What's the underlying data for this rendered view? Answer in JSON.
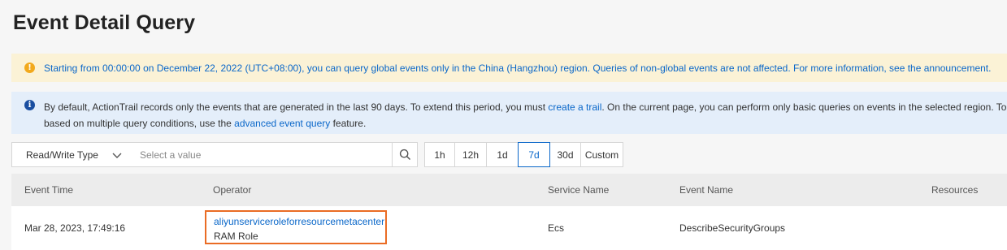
{
  "page_title": "Event Detail Query",
  "warning_banner": {
    "icon": "warning-icon",
    "text": "Starting from 00:00:00 on December 22, 2022 (UTC+08:00), you can query global events only in the China (Hangzhou) region. Queries of non-global events are not affected. For more information, see the announcement."
  },
  "info_banner": {
    "icon": "info-icon",
    "line1_before": "By default, ActionTrail records only the events that are generated in the last 90 days. To extend this period, you must ",
    "line1_link": "create a trail",
    "line1_after": ". On the current page, you can perform only basic queries on events in the selected region. To q",
    "line2_before": "based on multiple query conditions, use the ",
    "line2_link": "advanced event query",
    "line2_after": " feature."
  },
  "toolbar": {
    "filter_select_label": "Read/Write Type",
    "value_placeholder": "Select a value",
    "time_ranges": [
      "1h",
      "12h",
      "1d",
      "7d",
      "30d",
      "Custom"
    ],
    "selected_range": "7d"
  },
  "table": {
    "columns": [
      "Event Time",
      "Operator",
      "Service Name",
      "Event Name",
      "Resources"
    ],
    "rows": [
      {
        "event_time": "Mar 28, 2023, 17:49:16",
        "operator_name": "aliyunserviceroleforresourcemetacenter",
        "operator_type": "RAM Role",
        "service_name": "Ecs",
        "event_name": "DescribeSecurityGroups",
        "resources": ""
      }
    ]
  },
  "colors": {
    "accent": "#0a67c9",
    "warning_bg": "#fbf2d6",
    "info_bg": "#e4eefa",
    "highlight_border": "#ea6c24"
  }
}
